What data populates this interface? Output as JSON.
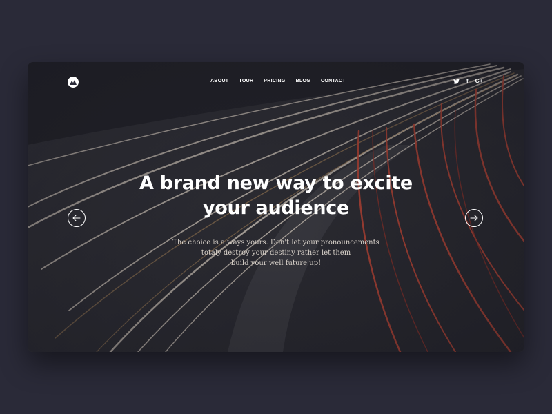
{
  "nav": {
    "menu": [
      "ABOUT",
      "TOUR",
      "PRICING",
      "BLOG",
      "CONTACT"
    ],
    "social": [
      {
        "name": "twitter-icon"
      },
      {
        "name": "facebook-icon",
        "glyph": "f"
      },
      {
        "name": "google-plus-icon",
        "glyph": "G+"
      }
    ]
  },
  "hero": {
    "headline_line1": "A brand new way to excite",
    "headline_line2": "your audience",
    "subtext_line1": "The choice is always yours. Don't let your pronouncements",
    "subtext_line2": "totaly destroy your destiny rather let them",
    "subtext_line3": "build your well future up!"
  },
  "colors": {
    "page_background": "#2a2a38",
    "text": "#ffffff",
    "light_trail_white": "#f2e6d6",
    "light_trail_red": "#e2503a"
  }
}
